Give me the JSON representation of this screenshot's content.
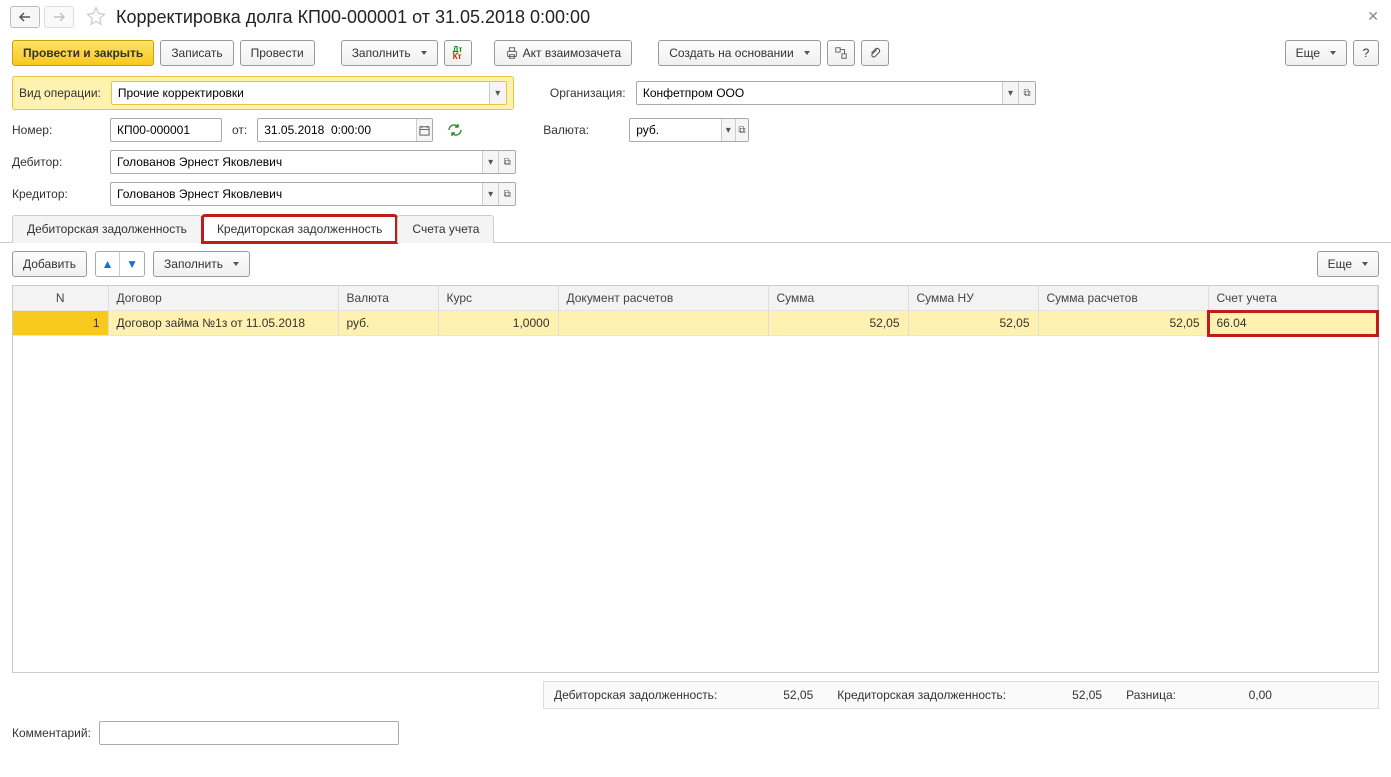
{
  "title": "Корректировка долга КП00-000001 от 31.05.2018 0:00:00",
  "toolbar": {
    "post_close": "Провести и закрыть",
    "save": "Записать",
    "post": "Провести",
    "fill": "Заполнить",
    "offset_act": "Акт взаимозачета",
    "create_based": "Создать на основании",
    "more": "Еще",
    "help": "?"
  },
  "fields": {
    "op_type_label": "Вид операции:",
    "op_type": "Прочие корректировки",
    "org_label": "Организация:",
    "org": "Конфетпром ООО",
    "number_label": "Номер:",
    "number": "КП00-000001",
    "from_label": "от:",
    "date": "31.05.2018  0:00:00",
    "currency_label": "Валюта:",
    "currency": "руб.",
    "debtor_label": "Дебитор:",
    "debtor": "Голованов Эрнест Яковлевич",
    "creditor_label": "Кредитор:",
    "creditor": "Голованов Эрнест Яковлевич"
  },
  "tabs": {
    "t1": "Дебиторская задолженность",
    "t2": "Кредиторская задолженность",
    "t3": "Счета учета"
  },
  "tab_toolbar": {
    "add": "Добавить",
    "fill": "Заполнить",
    "more": "Еще"
  },
  "grid": {
    "headers": {
      "n": "N",
      "contract": "Договор",
      "currency": "Валюта",
      "rate": "Курс",
      "doc": "Документ расчетов",
      "sum": "Сумма",
      "sum_nu": "Сумма НУ",
      "sum_settl": "Сумма расчетов",
      "account": "Счет учета"
    },
    "rows": [
      {
        "n": "1",
        "contract": "Договор займа №1з от 11.05.2018",
        "currency": "руб.",
        "rate": "1,0000",
        "doc": "",
        "sum": "52,05",
        "sum_nu": "52,05",
        "sum_settl": "52,05",
        "account": "66.04"
      }
    ]
  },
  "totals": {
    "debtor_label": "Дебиторская задолженность:",
    "debtor_val": "52,05",
    "creditor_label": "Кредиторская задолженность:",
    "creditor_val": "52,05",
    "diff_label": "Разница:",
    "diff_val": "0,00"
  },
  "comment_label": "Комментарий:"
}
